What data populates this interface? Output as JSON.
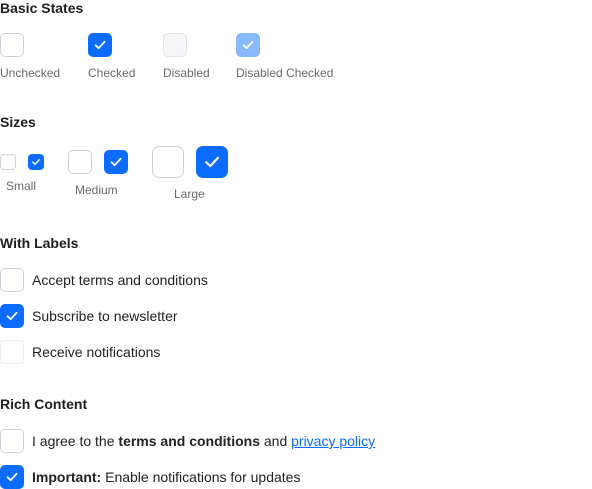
{
  "sections": {
    "basic": {
      "title": "Basic States",
      "items": [
        {
          "label": "Unchecked"
        },
        {
          "label": "Checked"
        },
        {
          "label": "Disabled"
        },
        {
          "label": "Disabled Checked"
        }
      ]
    },
    "sizes": {
      "title": "Sizes",
      "items": [
        {
          "label": "Small"
        },
        {
          "label": "Medium"
        },
        {
          "label": "Large"
        }
      ]
    },
    "labels": {
      "title": "With Labels",
      "items": [
        {
          "label": "Accept terms and conditions",
          "checked": false
        },
        {
          "label": "Subscribe to newsletter",
          "checked": true
        },
        {
          "label": "Receive notifications",
          "checked": false,
          "disabled": true
        }
      ]
    },
    "rich": {
      "title": "Rich Content",
      "item1": {
        "prefix": "I agree to the ",
        "bold": "terms and conditions",
        "middle": " and ",
        "link": "privacy policy"
      },
      "item2": {
        "bold": "Important:",
        "rest": " Enable notifications for updates"
      }
    }
  },
  "colors": {
    "accent": "#0b6cff",
    "disabled_checked": "#8ab8ff",
    "border": "#cfd1dc"
  }
}
